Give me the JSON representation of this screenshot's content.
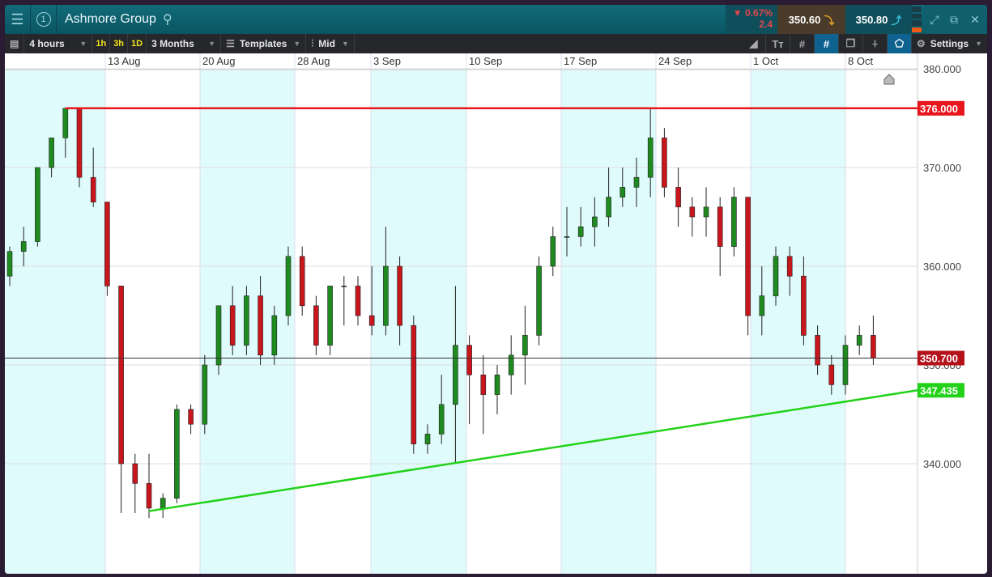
{
  "window": {
    "title": "Ashmore Group",
    "badge": "1"
  },
  "quote": {
    "change_pct": "▼ 0.67%",
    "change_abs": "2.4",
    "sell": "350.60",
    "buy": "350.80"
  },
  "toolbar": {
    "interval": "4 hours",
    "quick": [
      "1h",
      "3h",
      "1D"
    ],
    "range": "3 Months",
    "templates": "Templates",
    "price_type": "Mid",
    "settings": "Settings"
  },
  "colors": {
    "up": "#1f8a1f",
    "down": "#c8161d",
    "resistance": "#e8161d",
    "support": "#22d21a",
    "band": "#e0fbfb"
  },
  "chart_data": {
    "type": "candlestick",
    "x_labels": [
      "13 Aug",
      "20 Aug",
      "28 Aug",
      "3 Sep",
      "10 Sep",
      "17 Sep",
      "24 Sep",
      "1 Oct",
      "8 Oct"
    ],
    "y_ticks": [
      "380.000",
      "370.000",
      "360.000",
      "350.000",
      "340.000"
    ],
    "y_tick_values": [
      380,
      370,
      360,
      350,
      340
    ],
    "ylim": [
      329.5,
      381.5
    ],
    "ohlc": [
      [
        359,
        362,
        358,
        361.5
      ],
      [
        361.5,
        364,
        360,
        362.5
      ],
      [
        362.5,
        370,
        362,
        370
      ],
      [
        370,
        373,
        369,
        373
      ],
      [
        373,
        376,
        371,
        376
      ],
      [
        376,
        376,
        368,
        369
      ],
      [
        369,
        372,
        366,
        366.5
      ],
      [
        366.5,
        366.5,
        357,
        358
      ],
      [
        358,
        358,
        335,
        340
      ],
      [
        340,
        341,
        335,
        338
      ],
      [
        338,
        341,
        334.5,
        335.5
      ],
      [
        335.5,
        337,
        334.5,
        336.5
      ],
      [
        336.5,
        346,
        336,
        345.5
      ],
      [
        345.5,
        346,
        343,
        344
      ],
      [
        344,
        351,
        343,
        350
      ],
      [
        350,
        356,
        349,
        356
      ],
      [
        356,
        358,
        351,
        352
      ],
      [
        352,
        358,
        351,
        357
      ],
      [
        357,
        359,
        350,
        351
      ],
      [
        351,
        356,
        350,
        355
      ],
      [
        355,
        362,
        354,
        361
      ],
      [
        361,
        362,
        355,
        356
      ],
      [
        356,
        357,
        351,
        352
      ],
      [
        352,
        358,
        351,
        358
      ],
      [
        358,
        359,
        354,
        358
      ],
      [
        358,
        359,
        354,
        355
      ],
      [
        355,
        360,
        353,
        354
      ],
      [
        354,
        364,
        353,
        360
      ],
      [
        360,
        361,
        352,
        354
      ],
      [
        354,
        355,
        341,
        342
      ],
      [
        342,
        344,
        341,
        343
      ],
      [
        343,
        349,
        342,
        346
      ],
      [
        346,
        358,
        340,
        352
      ],
      [
        352,
        353,
        344,
        349
      ],
      [
        349,
        351,
        343,
        347
      ],
      [
        347,
        350,
        345,
        349
      ],
      [
        349,
        353,
        347,
        351
      ],
      [
        351,
        356,
        348,
        353
      ],
      [
        353,
        361,
        352,
        360
      ],
      [
        360,
        364,
        359,
        363
      ],
      [
        363,
        366,
        361,
        363
      ],
      [
        363,
        366,
        362,
        364
      ],
      [
        364,
        367,
        362,
        365
      ],
      [
        365,
        370,
        364,
        367
      ],
      [
        367,
        370,
        366,
        368
      ],
      [
        368,
        371,
        366,
        369
      ],
      [
        369,
        376,
        367,
        373
      ],
      [
        373,
        374,
        367,
        368
      ],
      [
        368,
        370,
        364,
        366
      ],
      [
        366,
        367,
        363,
        365
      ],
      [
        365,
        368,
        363,
        366
      ],
      [
        366,
        367,
        359,
        362
      ],
      [
        362,
        368,
        361,
        367
      ],
      [
        367,
        367,
        353,
        355
      ],
      [
        355,
        360,
        353,
        357
      ],
      [
        357,
        362,
        356,
        361
      ],
      [
        361,
        362,
        357,
        359
      ],
      [
        359,
        361,
        352,
        353
      ],
      [
        353,
        354,
        349,
        350
      ],
      [
        350,
        351,
        347,
        348
      ],
      [
        348,
        353,
        347,
        352
      ],
      [
        352,
        354,
        351,
        353
      ],
      [
        353,
        355,
        350,
        350.7
      ]
    ],
    "resistance": {
      "value": 376.0,
      "label": "376.000",
      "from_index": 4
    },
    "support": {
      "from_index": 10,
      "from_value": 335.2,
      "value": 347.435,
      "label": "347.435"
    },
    "current": {
      "value": 350.7,
      "label": "350.700"
    }
  }
}
